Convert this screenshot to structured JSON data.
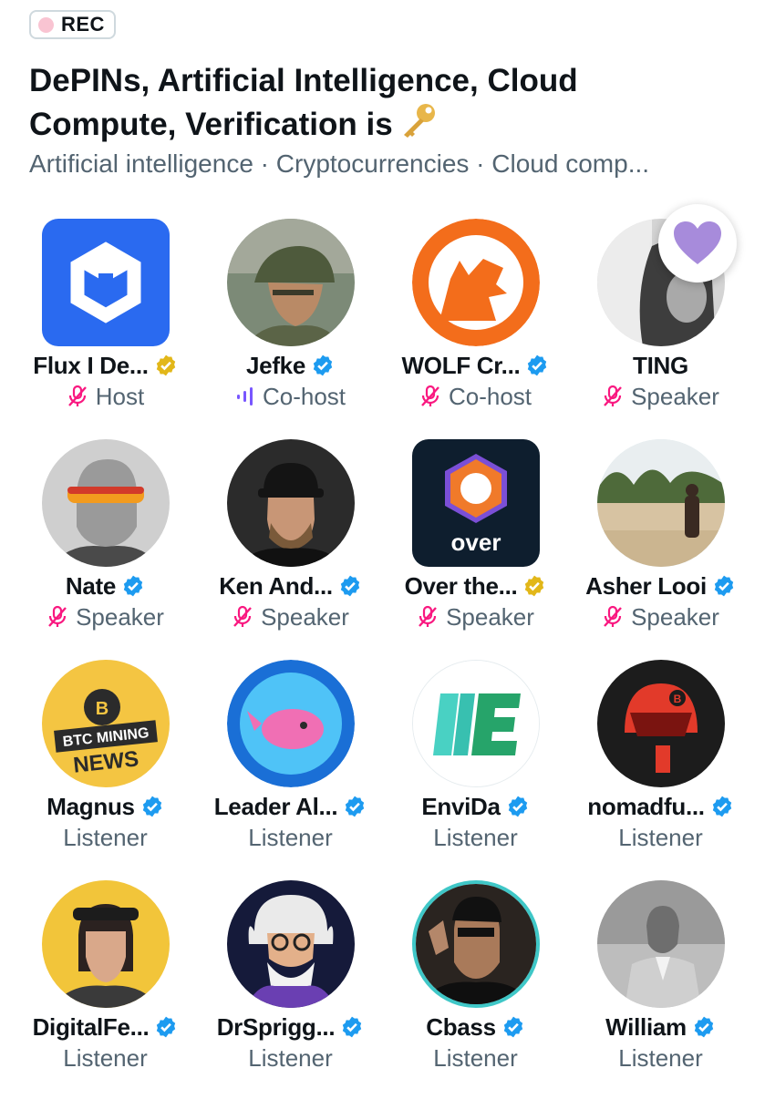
{
  "recording": {
    "label": "REC"
  },
  "space": {
    "title": "DePINs, Artificial Intelligence, Cloud Compute, Verification is",
    "title_icon": "key-icon",
    "topics": "Artificial intelligence · Cryptocurrencies · Cloud comp..."
  },
  "reaction": {
    "icon": "purple-heart-icon",
    "color": "#a78bdb"
  },
  "colors": {
    "verified_blue": "#1d9bf0",
    "verified_gold": "#e2b719",
    "muted_mic": "#f91880",
    "speaking_bars": "#7856ff",
    "secondary_text": "#536471"
  },
  "participants": [
    {
      "name": "Flux I De...",
      "badge": "gold",
      "role": "Host",
      "role_icon": "mic-muted-icon"
    },
    {
      "name": "Jefke",
      "badge": "blue",
      "role": "Co-host",
      "role_icon": "speaking-bars-icon"
    },
    {
      "name": "WOLF Cr...",
      "badge": "blue",
      "role": "Co-host",
      "role_icon": "mic-muted-icon"
    },
    {
      "name": "TING",
      "badge": "none",
      "role": "Speaker",
      "role_icon": "mic-muted-icon"
    },
    {
      "name": "Nate",
      "badge": "blue",
      "role": "Speaker",
      "role_icon": "mic-muted-icon"
    },
    {
      "name": "Ken And...",
      "badge": "blue",
      "role": "Speaker",
      "role_icon": "mic-muted-icon"
    },
    {
      "name": "Over the...",
      "badge": "gold",
      "role": "Speaker",
      "role_icon": "mic-muted-icon"
    },
    {
      "name": "Asher Looi",
      "badge": "blue",
      "role": "Speaker",
      "role_icon": "mic-muted-icon"
    },
    {
      "name": "Magnus",
      "badge": "blue",
      "role": "Listener",
      "role_icon": "none",
      "avatar_text": [
        "BTC MINING",
        "NEWS"
      ]
    },
    {
      "name": "Leader Al...",
      "badge": "blue",
      "role": "Listener",
      "role_icon": "none"
    },
    {
      "name": "EnviDa",
      "badge": "blue",
      "role": "Listener",
      "role_icon": "none"
    },
    {
      "name": "nomadfu...",
      "badge": "blue",
      "role": "Listener",
      "role_icon": "none"
    },
    {
      "name": "DigitalFe...",
      "badge": "blue",
      "role": "Listener",
      "role_icon": "none"
    },
    {
      "name": "DrSprigg...",
      "badge": "blue",
      "role": "Listener",
      "role_icon": "none"
    },
    {
      "name": "Cbass",
      "badge": "blue",
      "role": "Listener",
      "role_icon": "none"
    },
    {
      "name": "William",
      "badge": "blue",
      "role": "Listener",
      "role_icon": "none"
    }
  ],
  "logos": {
    "over": "over"
  }
}
